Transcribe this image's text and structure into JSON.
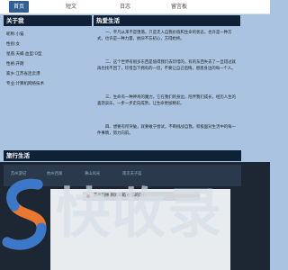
{
  "nav": {
    "items": [
      {
        "label": "首页"
      },
      {
        "label": "短文"
      },
      {
        "label": "日志"
      },
      {
        "label": "留言板"
      }
    ],
    "active_index": 0
  },
  "about": {
    "title": "关于我",
    "rows": [
      "昵称:小猫",
      "性别:女",
      "星座:天蝎 血型:O型",
      "性格:开朗",
      "家乡:江苏省连云港",
      "专业:计算机网络技术"
    ]
  },
  "hobbies": {
    "title": "热爱生活",
    "paragraphs": [
      "一、平凡从来不是堕落，只是走入自我价值和生命的状态，也许是一种方式，也许是一种力量，依旧不忘初心，方得始终。",
      "二、这个世界有很多东西是值得我们去珍惜的，有的东西失去了一旦错过就再也找不回了，珍惜当下拥有的一切，不要让自己后悔，感恩身边的每一个人。",
      "三、生命有一种神奇的魔力，它在我们的身边，陪伴我们成长，经历人生的喜怒哀乐，一步一步走向成熟，让生命更加精彩。",
      "四、想要有所突破，就要敢于尝试，不断挑战自我，积极面对生活中的每一件事情，努力向前。"
    ]
  },
  "travel": {
    "title": "旅行生活",
    "items": [
      "苏州游记",
      "杭州西湖",
      "黄山风光",
      "南京夫子庙"
    ],
    "panel_text": "苏州园林 网易邮箱 小猫的旅行"
  },
  "watermark": {
    "text": "快收录"
  },
  "colors": {
    "page_bg": "#a9c3e0",
    "header_bg": "#0f2136",
    "nav_active": "#2f5f93",
    "dark_band": "#1c2733"
  }
}
